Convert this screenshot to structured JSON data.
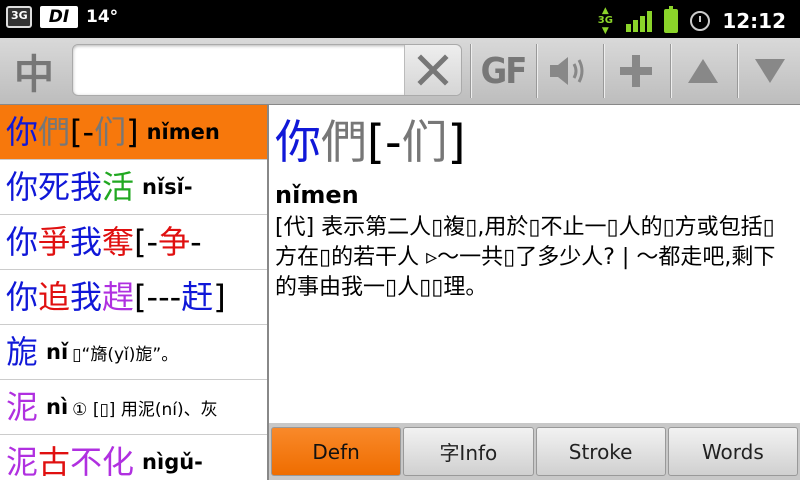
{
  "status_bar": {
    "left_icons": [
      "3g-data-icon",
      "di-app-icon"
    ],
    "icon_3g_label": "3G",
    "icon_di_label": "DI",
    "temperature": "14°",
    "network_label": "3G",
    "time": "12:12"
  },
  "toolbar": {
    "mode_label": "中",
    "search_value": "",
    "search_placeholder": "",
    "gf_label": "GF"
  },
  "list": {
    "items": [
      {
        "segments": [
          {
            "text": "你",
            "color": "blue"
          },
          {
            "text": "們",
            "color": "gray"
          },
          {
            "text": "[-",
            "color": "black"
          },
          {
            "text": "们",
            "color": "gray"
          },
          {
            "text": "]",
            "color": "black"
          }
        ],
        "pinyin": "nǐmen",
        "gloss": "",
        "selected": true
      },
      {
        "segments": [
          {
            "text": "你死我",
            "color": "blue"
          },
          {
            "text": "活",
            "color": "green"
          }
        ],
        "pinyin": "nǐsǐ-",
        "gloss": "",
        "selected": false
      },
      {
        "segments": [
          {
            "text": "你",
            "color": "blue"
          },
          {
            "text": "爭",
            "color": "red"
          },
          {
            "text": "我",
            "color": "blue"
          },
          {
            "text": "奪",
            "color": "red"
          },
          {
            "text": "[-",
            "color": "black"
          },
          {
            "text": "争",
            "color": "red"
          },
          {
            "text": "-",
            "color": "black"
          }
        ],
        "pinyin": "",
        "gloss": "",
        "selected": false
      },
      {
        "segments": [
          {
            "text": "你",
            "color": "blue"
          },
          {
            "text": "追",
            "color": "red"
          },
          {
            "text": "我",
            "color": "blue"
          },
          {
            "text": "趕",
            "color": "purple"
          },
          {
            "text": "[---",
            "color": "black"
          },
          {
            "text": "赶",
            "color": "blue"
          },
          {
            "text": "]",
            "color": "black"
          }
        ],
        "pinyin": "",
        "gloss": "",
        "selected": false
      },
      {
        "segments": [
          {
            "text": "旎",
            "color": "blue"
          }
        ],
        "pinyin": "nǐ",
        "gloss": "▯“旖(yǐ)旎”。",
        "selected": false
      },
      {
        "segments": [
          {
            "text": "泥",
            "color": "purple"
          }
        ],
        "pinyin": "nì",
        "gloss": "① [▯] 用泥(ní)、灰",
        "selected": false
      },
      {
        "segments": [
          {
            "text": "泥",
            "color": "purple"
          },
          {
            "text": "古",
            "color": "red"
          },
          {
            "text": "不化",
            "color": "purple"
          }
        ],
        "pinyin": "nìgǔ-",
        "gloss": "",
        "selected": false
      }
    ]
  },
  "detail": {
    "headword": [
      {
        "text": "你",
        "color": "blue"
      },
      {
        "text": "們",
        "color": "gray"
      },
      {
        "text": "[-",
        "color": "black"
      },
      {
        "text": "们",
        "color": "gray"
      },
      {
        "text": "]",
        "color": "black"
      }
    ],
    "pinyin": "nǐmen",
    "definition": "[代] 表示第二人▯複▯,用於▯不止一▯人的▯方或包括▯方在▯的若干人 ▹～一共▯了多少人? | ～都走吧,剩下的事由我一▯人▯▯理。"
  },
  "tabs": [
    {
      "label": "Defn",
      "active": true
    },
    {
      "label": "字Info",
      "active": false
    },
    {
      "label": "Stroke",
      "active": false
    },
    {
      "label": "Words",
      "active": false
    }
  ],
  "colors": {
    "accent": "#f7780c",
    "blue": "#1018d8",
    "gray": "#777777",
    "green": "#21a821",
    "red": "#e01010",
    "purple": "#b030e0",
    "black": "#000000",
    "status_green": "#8bd42a"
  },
  "icons": [
    "clear-icon",
    "speaker-icon",
    "add-icon",
    "up-arrow-icon",
    "down-arrow-icon",
    "signal-icon",
    "battery-icon",
    "alarm-icon"
  ]
}
